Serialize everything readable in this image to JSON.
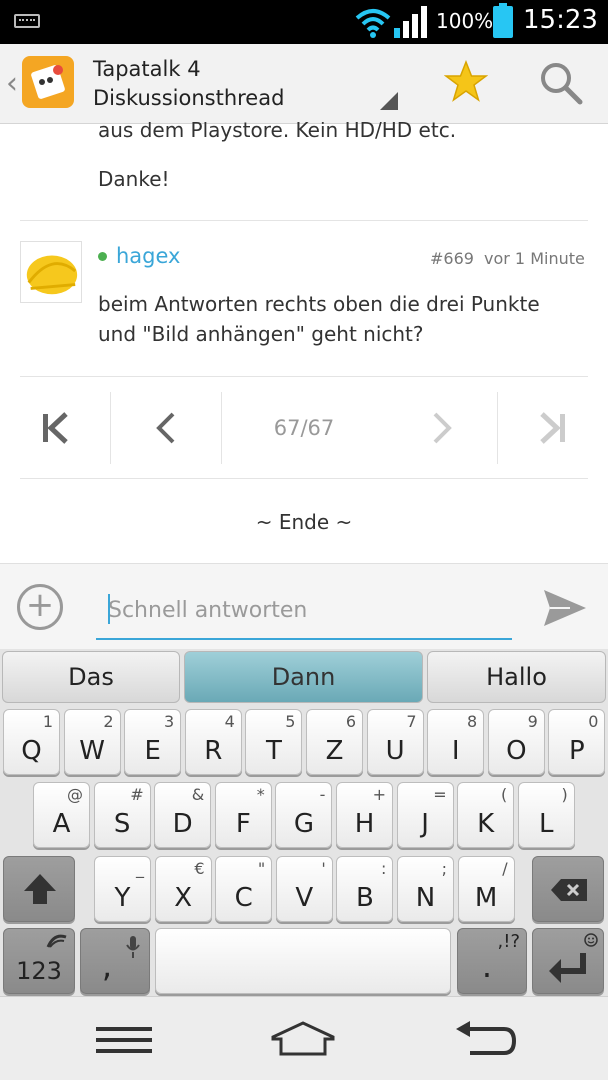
{
  "status_bar": {
    "battery": "100%",
    "time": "15:23"
  },
  "action_bar": {
    "title_line1": "Tapatalk 4",
    "title_line2": "Diskussionsthread"
  },
  "thread": {
    "cut_off_text": "aus dem Playstore. Kein HD/HD etc.",
    "previous_post_text": "Danke!",
    "post": {
      "username": "hagex",
      "post_number": "#669",
      "time": "vor 1 Minute",
      "text_line1": "beim Antworten rechts oben die drei Punkte",
      "text_line2": "und \"Bild anhängen\" geht nicht?"
    },
    "pagination": {
      "page_label": "67/67"
    },
    "end_label": "~ Ende ~"
  },
  "reply": {
    "placeholder": "Schnell antworten"
  },
  "keyboard": {
    "suggestions": [
      "Das",
      "Dann",
      "Hallo"
    ],
    "row1": [
      {
        "k": "Q",
        "s": "1"
      },
      {
        "k": "W",
        "s": "2"
      },
      {
        "k": "E",
        "s": "3"
      },
      {
        "k": "R",
        "s": "4"
      },
      {
        "k": "T",
        "s": "5"
      },
      {
        "k": "Z",
        "s": "6"
      },
      {
        "k": "U",
        "s": "7"
      },
      {
        "k": "I",
        "s": "8"
      },
      {
        "k": "O",
        "s": "9"
      },
      {
        "k": "P",
        "s": "0"
      }
    ],
    "row2": [
      {
        "k": "A",
        "s": "@"
      },
      {
        "k": "S",
        "s": "#"
      },
      {
        "k": "D",
        "s": "&"
      },
      {
        "k": "F",
        "s": "*"
      },
      {
        "k": "G",
        "s": "-"
      },
      {
        "k": "H",
        "s": "+"
      },
      {
        "k": "J",
        "s": "="
      },
      {
        "k": "K",
        "s": "("
      },
      {
        "k": "L",
        "s": ")"
      }
    ],
    "row3": [
      {
        "k": "Y",
        "s": "_"
      },
      {
        "k": "X",
        "s": "€"
      },
      {
        "k": "C",
        "s": "\""
      },
      {
        "k": "V",
        "s": "'"
      },
      {
        "k": "B",
        "s": ":"
      },
      {
        "k": "N",
        "s": ";"
      },
      {
        "k": "M",
        "s": "/"
      }
    ],
    "num_key": "123",
    "comma_key": ",",
    "period_key": ".",
    "period_sub": ",!?"
  },
  "colors": {
    "accent": "#3aa6d8",
    "star": "#f5c518",
    "online": "#4caf50"
  }
}
